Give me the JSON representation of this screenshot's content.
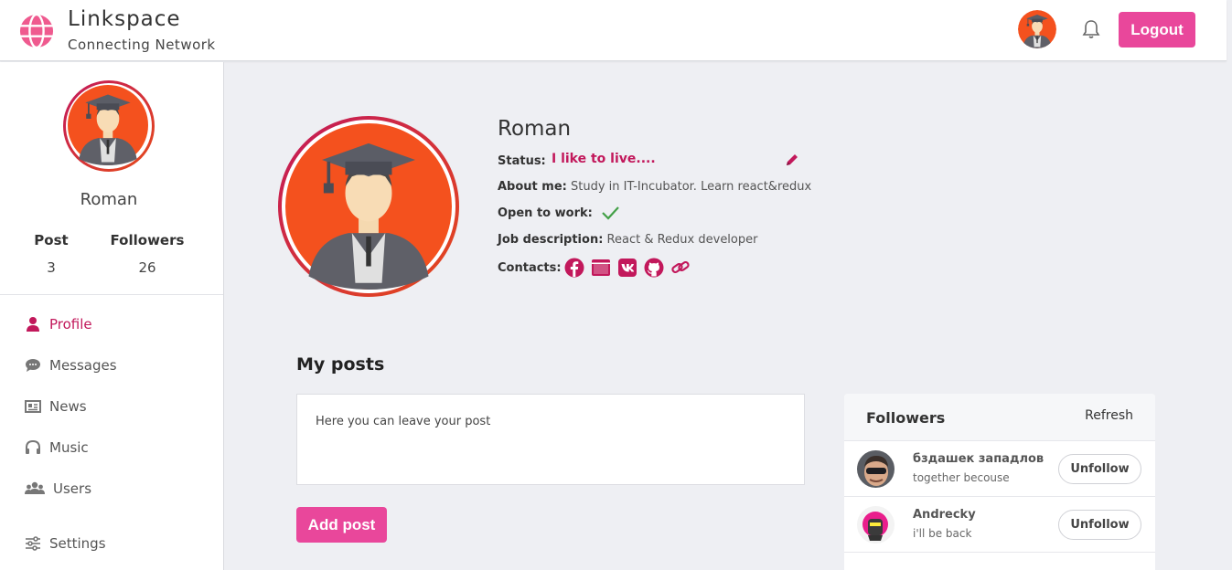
{
  "brand": {
    "title": "Linkspace",
    "subtitle": "Connecting Network"
  },
  "header": {
    "logout_label": "Logout"
  },
  "sidebar": {
    "name": "Roman",
    "stats": [
      {
        "label": "Post",
        "value": "3"
      },
      {
        "label": "Followers",
        "value": "26"
      }
    ],
    "nav": [
      {
        "label": "Profile",
        "icon": "user-icon",
        "active": true
      },
      {
        "label": "Messages",
        "icon": "chat-icon"
      },
      {
        "label": "News",
        "icon": "newspaper-icon"
      },
      {
        "label": "Music",
        "icon": "headphones-icon"
      },
      {
        "label": "Users",
        "icon": "users-icon"
      },
      {
        "label": "Settings",
        "icon": "sliders-icon"
      }
    ]
  },
  "profile": {
    "name": "Roman",
    "status_label": "Status:",
    "status_value": "I like to live....",
    "about_label": "About me:",
    "about_value": "Study in IT-Incubator. Learn react&redux",
    "open_label": "Open to work:",
    "job_label": "Job description:",
    "job_value": "React & Redux developer",
    "contacts_label": "Contacts:",
    "contacts": [
      "facebook-icon",
      "website-icon",
      "vk-icon",
      "github-icon",
      "link-icon"
    ]
  },
  "posts": {
    "title": "My posts",
    "placeholder": "Here you can leave your post",
    "add_label": "Add post"
  },
  "followers": {
    "title": "Followers",
    "refresh_label": "Refresh",
    "items": [
      {
        "name": "бздашек западлов",
        "status": "together becouse",
        "action": "Unfollow"
      },
      {
        "name": "Andrecky",
        "status": "i'll be back",
        "action": "Unfollow"
      }
    ]
  },
  "colors": {
    "accent": "#c2185b",
    "button": "#e9479b",
    "check": "#43a047"
  }
}
